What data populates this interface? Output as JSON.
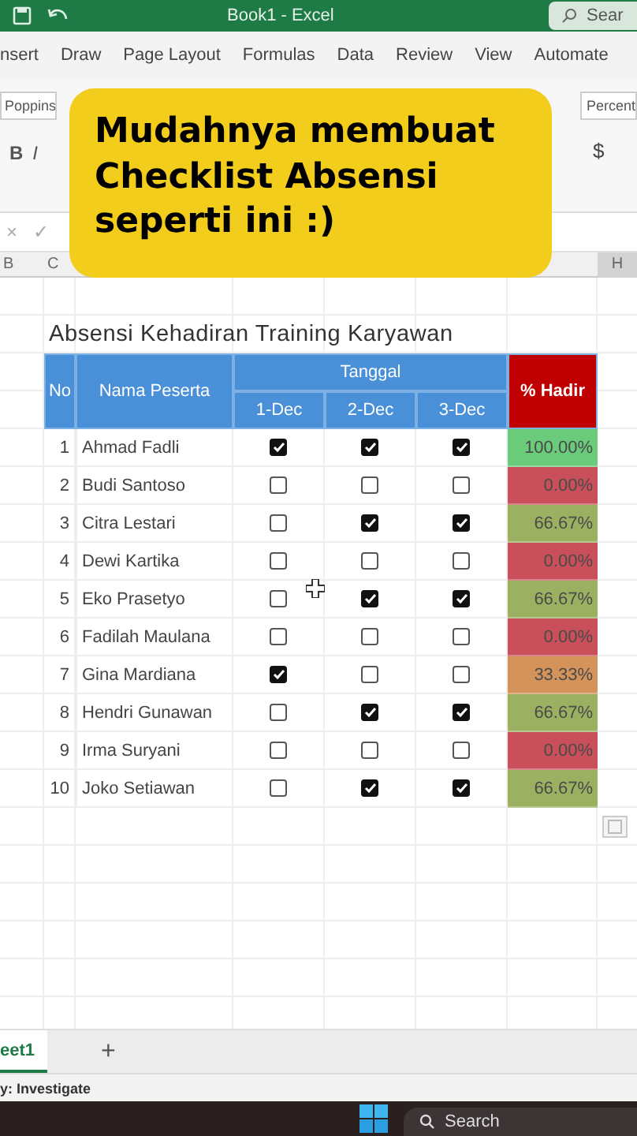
{
  "window": {
    "title": "Book1 - Excel",
    "search": "Sear"
  },
  "ribbon_tabs": [
    "nsert",
    "Draw",
    "Page Layout",
    "Formulas",
    "Data",
    "Review",
    "View",
    "Automate"
  ],
  "ribbon": {
    "font": "Poppins",
    "bold": "B",
    "italic": "I",
    "number_format": "Percent",
    "currency": "$"
  },
  "overlay": {
    "text": "Mudahnya membuat Checklist Absensi seperti ini :)"
  },
  "formula_bar": {
    "cancel": "×",
    "enter": "✓"
  },
  "column_headers": [
    "B",
    "C",
    "H"
  ],
  "sheet": {
    "title": "Absensi Kehadiran Training Karyawan",
    "no_header": "No",
    "name_header": "Nama Peserta",
    "date_group": "Tanggal",
    "dates": [
      "1-Dec",
      "2-Dec",
      "3-Dec"
    ],
    "percent_header": "% Hadir",
    "rows": [
      {
        "no": "1",
        "name": "Ahmad Fadli",
        "checks": [
          true,
          true,
          true
        ],
        "percent": "100.00%",
        "color": "#6acc7a"
      },
      {
        "no": "2",
        "name": "Budi Santoso",
        "checks": [
          false,
          false,
          false
        ],
        "percent": "0.00%",
        "color": "#c9505a"
      },
      {
        "no": "3",
        "name": "Citra Lestari",
        "checks": [
          false,
          true,
          true
        ],
        "percent": "66.67%",
        "color": "#9bb060"
      },
      {
        "no": "4",
        "name": "Dewi Kartika",
        "checks": [
          false,
          false,
          false
        ],
        "percent": "0.00%",
        "color": "#c9505a"
      },
      {
        "no": "5",
        "name": "Eko Prasetyo",
        "checks": [
          false,
          true,
          true
        ],
        "percent": "66.67%",
        "color": "#9bb060"
      },
      {
        "no": "6",
        "name": "Fadilah Maulana",
        "checks": [
          false,
          false,
          false
        ],
        "percent": "0.00%",
        "color": "#c9505a"
      },
      {
        "no": "7",
        "name": "Gina Mardiana",
        "checks": [
          true,
          false,
          false
        ],
        "percent": "33.33%",
        "color": "#d4935a"
      },
      {
        "no": "8",
        "name": "Hendri Gunawan",
        "checks": [
          false,
          true,
          true
        ],
        "percent": "66.67%",
        "color": "#9bb060"
      },
      {
        "no": "9",
        "name": "Irma Suryani",
        "checks": [
          false,
          false,
          false
        ],
        "percent": "0.00%",
        "color": "#c9505a"
      },
      {
        "no": "10",
        "name": "Joko Setiawan",
        "checks": [
          false,
          true,
          true
        ],
        "percent": "66.67%",
        "color": "#9bb060"
      }
    ]
  },
  "sheet_tabs": [
    {
      "label": "eet1",
      "selected": true
    }
  ],
  "add_sheet": "+",
  "status_bar": "y: Investigate",
  "taskbar": {
    "search": "Search"
  }
}
